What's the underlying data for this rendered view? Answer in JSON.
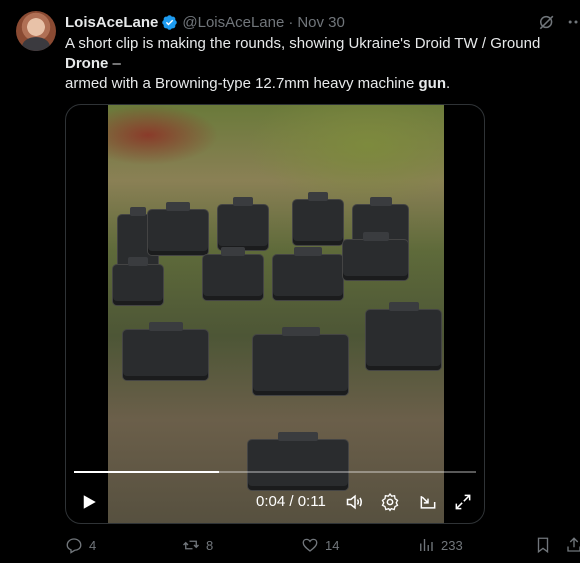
{
  "post": {
    "author_name": "LoisAceLane",
    "handle": "@LoisAceLane",
    "separator": "·",
    "date": "Nov 30",
    "text_part1": "A short clip is making the rounds, showing Ukraine's Droid TW / Ground ",
    "text_bold1": "Drone",
    "text_part2": " –",
    "text_part3": "armed with a Browning-type 12.7mm heavy machine ",
    "text_bold2": "gun",
    "text_part4": "."
  },
  "video": {
    "current_time": "0:04",
    "time_separator": " / ",
    "duration": "0:11",
    "progress_fraction": 0.36
  },
  "actions": {
    "replies": "4",
    "reposts": "8",
    "likes": "14",
    "views": "233"
  },
  "colors": {
    "verified": "#1d9bf0",
    "muted": "#71767b",
    "text": "#e7e9ea"
  },
  "icons": [
    "verified-badge-icon",
    "grok-icon",
    "more-icon",
    "play-icon",
    "volume-icon",
    "settings-icon",
    "pip-icon",
    "fullscreen-icon",
    "reply-icon",
    "repost-icon",
    "like-icon",
    "views-icon",
    "bookmark-icon",
    "share-icon"
  ]
}
